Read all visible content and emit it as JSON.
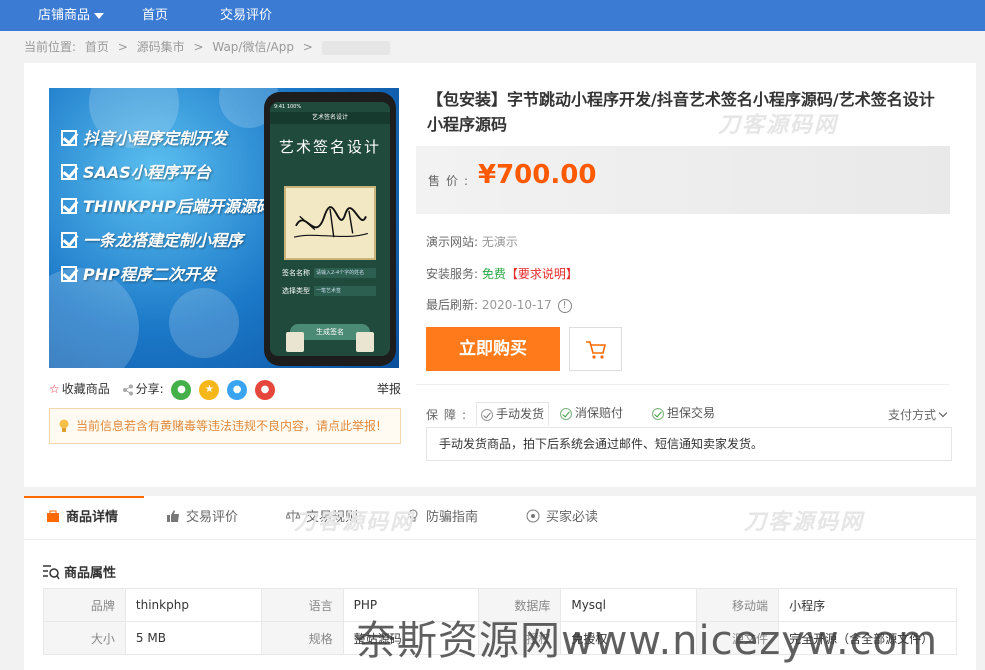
{
  "nav": {
    "store_products": "店铺商品",
    "home": "首页",
    "reviews": "交易评价"
  },
  "breadcrumb": {
    "prefix": "当前位置:",
    "items": [
      "首页",
      ">",
      "源码集市",
      ">",
      "Wap/微信/App",
      ">"
    ]
  },
  "hero": {
    "lines": [
      "抖音小程序定制开发",
      "SAAS小程序平台",
      "THINKPHP后端开源源码",
      "一条龙搭建定制小程序",
      "PHP程序二次开发"
    ],
    "phone_app_title": "艺术签名设计",
    "phone_big_title": "艺术签名设计",
    "phone_field1_label": "签名名称",
    "phone_field1_placeholder": "请输入2-4个字的姓名",
    "phone_field2_label": "选择类型",
    "phone_field2_value": "一笔艺术签",
    "phone_button": "生成签名",
    "phone_status": "9:41  100%"
  },
  "social": {
    "favorite": "收藏商品",
    "share": "分享:",
    "report": "举报"
  },
  "warning": "当前信息若含有黄赌毒等违法违规不良内容，请点此举报!",
  "product": {
    "title": "【包安装】字节跳动小程序开发/抖音艺术签名小程序源码/艺术签名设计小程序源码",
    "price_label": "售价:",
    "price": "¥700.00",
    "demo_label": "演示网站:",
    "demo_value": "无演示",
    "install_label": "安装服务:",
    "install_value": "免费",
    "install_note": "【要求说明】",
    "refresh_label": "最后刷新:",
    "refresh_value": "2020-10-17",
    "buy_button": "立即购买"
  },
  "guarantee": {
    "label": "保障:",
    "tabs": [
      "手动发货",
      "消保赔付",
      "担保交易"
    ],
    "payment": "支付方式",
    "description": "手动发货商品，拍下后系统会通过邮件、短信通知卖家发货。"
  },
  "watermark": "刀客源码网",
  "detail_tabs": [
    "商品详情",
    "交易评价",
    "交易规则",
    "防骗指南",
    "买家必读"
  ],
  "attributes_title": "商品属性",
  "attributes": [
    [
      [
        "品牌",
        "thinkphp"
      ],
      [
        "语言",
        "PHP"
      ],
      [
        "数据库",
        "Mysql"
      ],
      [
        "移动端",
        "小程序"
      ]
    ],
    [
      [
        "大小",
        "5 MB"
      ],
      [
        "规格",
        "整站源码"
      ],
      [
        "授权",
        "免授权"
      ],
      [
        "源文件",
        "完全开源（含全部源文件）"
      ]
    ]
  ],
  "site_watermark": "奈斯资源网www.nicezyw.com",
  "colors": {
    "nav_bg": "#3b7bd3",
    "price": "#ff5a00",
    "buy_button": "#ff7a1a",
    "free": "#28a745",
    "active_tab_border": "#ff6a00"
  }
}
